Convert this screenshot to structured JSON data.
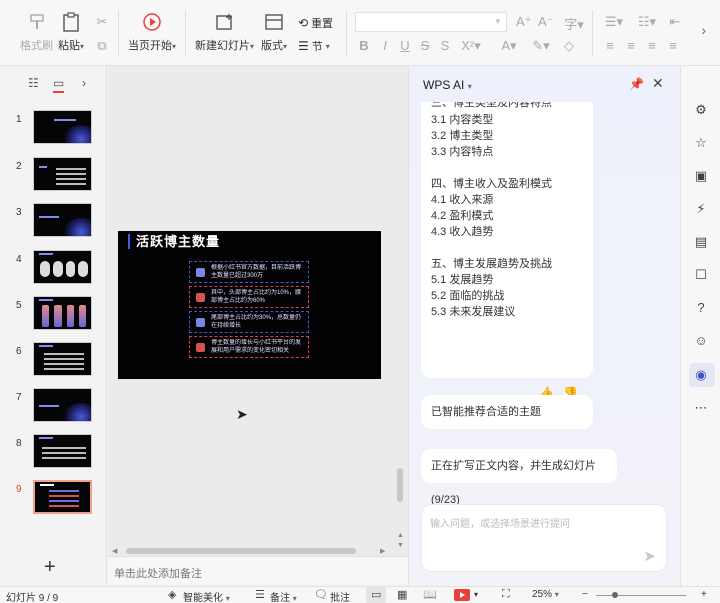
{
  "ribbon": {
    "format_painter": "格式刷",
    "paste": "粘贴",
    "start_from_current": "当页开始",
    "new_slide": "新建幻灯片",
    "layout": "版式",
    "reset": "重置",
    "section": "节"
  },
  "thumbnails": {
    "slide_numbers": [
      "1",
      "2",
      "3",
      "4",
      "5",
      "6",
      "7",
      "8",
      "9"
    ],
    "active_index": 9
  },
  "slide": {
    "title": "活跃博主数量",
    "items": [
      "根据小红书官方数据，目前活跃博主数量已超过300万",
      "其中，头部博主占比约为10%，腰部博主占比约为60%",
      "尾部博主占比约为30%，总数量仍在持续增长",
      "博主数量的增长与小红书平台的发展和用户需求的变化密切相关"
    ]
  },
  "notes": {
    "placeholder": "单击此处添加备注"
  },
  "ai": {
    "title": "WPS AI",
    "outline_cut": "三、博主类型及内容特点",
    "outline": [
      "3.1 内容类型",
      "3.2 博主类型",
      "3.3 内容特点",
      "",
      "四、博主收入及盈利模式",
      "4.1 收入来源",
      "4.2 盈利模式",
      "4.3 收入趋势",
      "",
      "五、博主发展趋势及挑战",
      "5.1 发展趋势",
      "5.2 面临的挑战",
      "5.3 未来发展建议"
    ],
    "msg_theme": "已智能推荐合适的主题",
    "msg_progress": "正在扩写正文内容，并生成幻灯片 (9/23)",
    "input_placeholder": "输入问题，或选择场景进行提问"
  },
  "status": {
    "slide_counter": "幻灯片 9 / 9",
    "smart_beautify": "智能美化",
    "notes": "备注",
    "comments": "批注",
    "zoom": "25%"
  },
  "colors": {
    "accent": "#e8413a",
    "slide_bg": "#030305",
    "slide_border": "#4651c8"
  }
}
